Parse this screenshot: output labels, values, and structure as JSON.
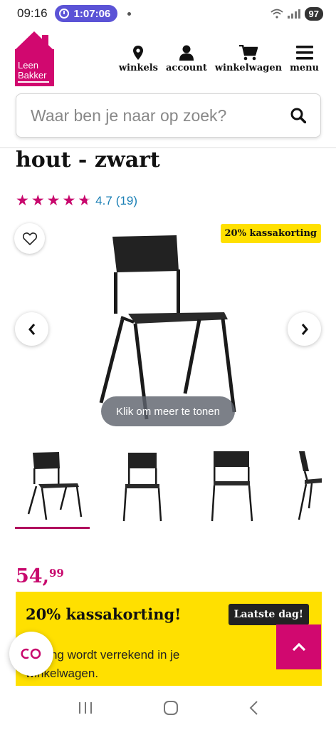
{
  "status_bar": {
    "time": "09:16",
    "timer": "1:07:06",
    "battery": "97"
  },
  "header": {
    "logo_line1": "Leen",
    "logo_line2": "Bakker",
    "nav": [
      {
        "label": "winkels",
        "icon": "location-pin-icon"
      },
      {
        "label": "account",
        "icon": "user-icon"
      },
      {
        "label": "winkelwagen",
        "icon": "cart-icon"
      },
      {
        "label": "menu",
        "icon": "hamburger-menu-icon"
      }
    ]
  },
  "search": {
    "placeholder": "Waar ben je naar op zoek?"
  },
  "product": {
    "title": "hout - zwart",
    "rating_value": "4.7",
    "rating_count": "(19)",
    "rating_stars": 4.7,
    "badge": "20% kassakorting",
    "show_more": "Klik om meer te tonen",
    "price_main": "54,",
    "price_cents": "99"
  },
  "promo": {
    "title": "20% kassakorting!",
    "tag": "Laatste dag!",
    "text": "Korting wordt verrekend in je winkelwagen."
  },
  "colors": {
    "brand": "#d1086f",
    "promo_yellow": "#ffe000",
    "link": "#1a7fb5"
  }
}
